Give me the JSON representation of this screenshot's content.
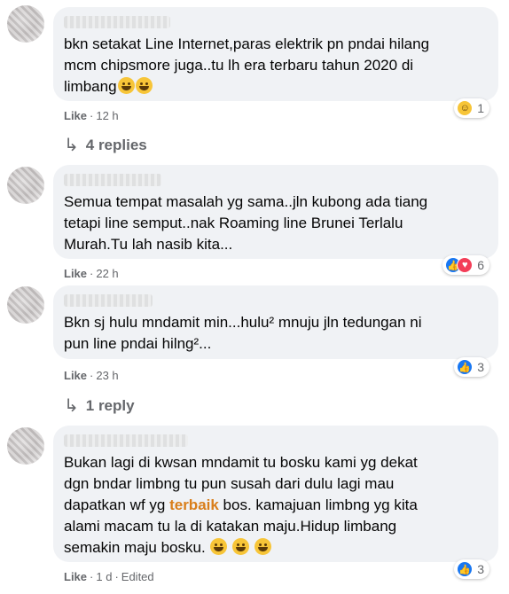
{
  "comments": [
    {
      "text": "bkn setakat Line Internet,paras elektrik pn pndai hilang\nmcm chipsmore juga..tu lh era terbaru tahun 2020 di\nlimbang",
      "like": "Like",
      "time": "12 h",
      "reaction_count": "1",
      "reaction_types": [
        "haha"
      ],
      "replies": "4 replies"
    },
    {
      "text": "Semua tempat masalah yg sama..jln kubong ada tiang\ntetapi line semput..nak Roaming line Brunei Terlalu\nMurah.Tu lah nasib kita...",
      "like": "Like",
      "time": "22 h",
      "reaction_count": "6",
      "reaction_types": [
        "like",
        "love"
      ]
    },
    {
      "text": "Bkn sj hulu mndamit min...hulu² mnuju jln tedungan ni\npun line pndai hilng²...",
      "like": "Like",
      "time": "23 h",
      "reaction_count": "3",
      "reaction_types": [
        "like"
      ],
      "replies": "1 reply"
    },
    {
      "text_before": "Bukan lagi di kwsan mndamit tu bosku kami yg dekat\ndgn bndar limbng tu pun susah dari dulu lagi mau\ndapatkan wf yg ",
      "text_highlight": "terbaik",
      "text_after": " bos. kamajuan limbng yg kita\nalami macam tu la di katakan maju.Hidup limbang\nsemakin maju bosku. ",
      "like": "Like",
      "time": "1 d",
      "edited": "Edited",
      "reaction_count": "3",
      "reaction_types": [
        "like"
      ]
    }
  ],
  "icons": {
    "reply_arrow": "reply-arrow-icon",
    "like_reaction": "like-reaction-icon",
    "love_reaction": "love-reaction-icon",
    "haha_reaction": "haha-reaction-icon",
    "emoji": "grinning-emoji"
  },
  "colors": {
    "bubble": "#f0f2f5",
    "meta": "#65676b",
    "like_blue": "#1877f2",
    "love_red": "#f33e58",
    "highlight": "#d97e1a"
  }
}
